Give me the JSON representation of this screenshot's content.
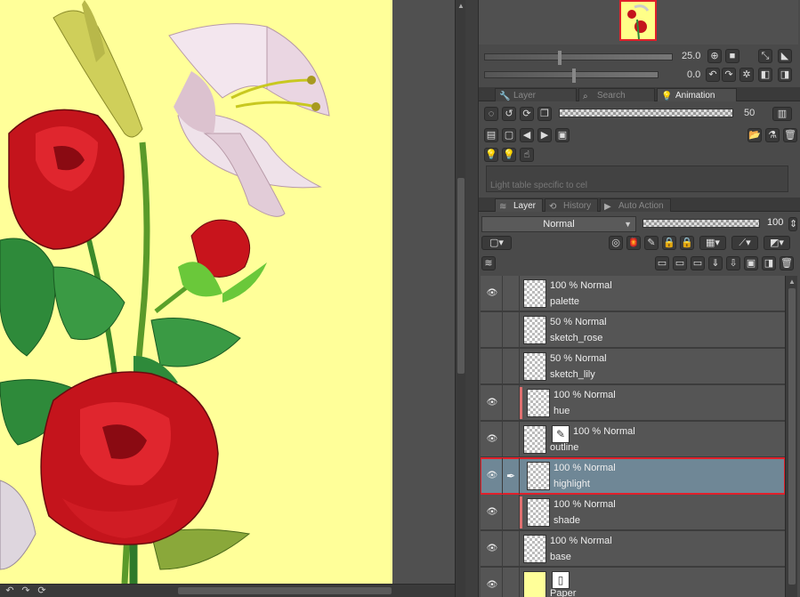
{
  "canvas": {
    "background_color": "#ffff99",
    "outer_color": "#505050",
    "bottom_icons": [
      "undo-icon",
      "redo-icon",
      "rotate-icon"
    ]
  },
  "navigator": {
    "zoom_value": "25.0",
    "rotation_value": "0.0"
  },
  "property_panel": {
    "tabs": [
      {
        "label": "Layer Property",
        "icon": "wrench-icon",
        "active": false
      },
      {
        "label": "Search Layer",
        "icon": "search-icon",
        "active": false
      },
      {
        "label": "Animation cels",
        "icon": "lightbulb-icon",
        "active": true
      }
    ],
    "opacity_value": "50",
    "light_table_placeholder": "Light table specific to cel"
  },
  "layer_panel": {
    "tabs": [
      {
        "label": "Layer",
        "icon": "layers-icon",
        "active": true
      },
      {
        "label": "History",
        "icon": "history-icon",
        "active": false
      },
      {
        "label": "Auto Action",
        "icon": "auto-action-icon",
        "active": false
      }
    ],
    "blend_mode": "Normal",
    "opacity_value": "100",
    "layers": [
      {
        "info": "100 % Normal",
        "name": "palette",
        "visible": true,
        "has_red_bar": false,
        "thumb": "transparent",
        "selected": false
      },
      {
        "info": "50 % Normal",
        "name": "sketch_rose",
        "visible": false,
        "has_red_bar": false,
        "thumb": "transparent",
        "selected": false
      },
      {
        "info": "50 % Normal",
        "name": "sketch_lily",
        "visible": false,
        "has_red_bar": false,
        "thumb": "transparent",
        "selected": false
      },
      {
        "info": "100 % Normal",
        "name": "hue",
        "visible": true,
        "has_red_bar": true,
        "thumb": "flowers",
        "selected": false
      },
      {
        "info": "100 % Normal",
        "name": "outline",
        "visible": true,
        "has_red_bar": false,
        "thumb": "vector",
        "selected": false
      },
      {
        "info": "100 % Normal",
        "name": "highlight",
        "visible": true,
        "has_red_bar": false,
        "thumb": "transparent",
        "selected": true
      },
      {
        "info": "100 % Normal",
        "name": "shade",
        "visible": true,
        "has_red_bar": true,
        "thumb": "flowers",
        "selected": false
      },
      {
        "info": "100 % Normal",
        "name": "base",
        "visible": true,
        "has_red_bar": false,
        "thumb": "flowers",
        "selected": false
      },
      {
        "info": "",
        "name": "Paper",
        "visible": true,
        "has_red_bar": false,
        "thumb": "paper",
        "selected": false
      }
    ]
  }
}
